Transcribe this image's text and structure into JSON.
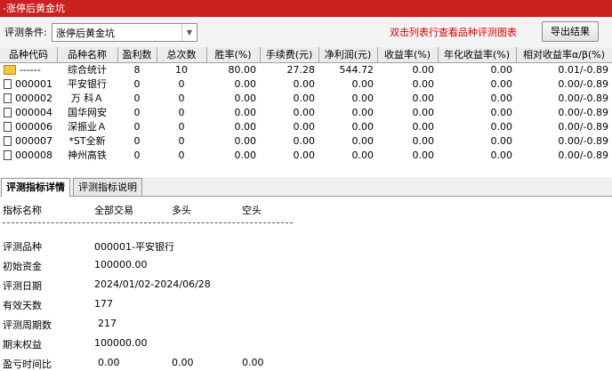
{
  "window": {
    "title": "-涨停后黄金坑"
  },
  "toolbar": {
    "condition_label": "评测条件:",
    "condition_value": "涨停后黄金坑",
    "hint": "双击列表行查看品种评测图表",
    "export_label": "导出结果"
  },
  "table": {
    "headers": [
      "品种代码",
      "品种名称",
      "盈利数",
      "总次数",
      "胜率(%)",
      "手续费(元)",
      "净利润(元)",
      "收益率(%)",
      "年化收益率(%)",
      "相对收益率α/β(%)"
    ],
    "rows": [
      {
        "code": "------",
        "name": "综合统计",
        "wins": "8",
        "total": "10",
        "win_rate": "80.00",
        "fee": "27.28",
        "profit": "544.72",
        "ret": "0.00",
        "annual": "0.00",
        "rel": "0.01/-0.89",
        "icon": "folder-icon"
      },
      {
        "code": "000001",
        "name": "平安银行",
        "wins": "0",
        "total": "0",
        "win_rate": "0.00",
        "fee": "0.00",
        "profit": "0.00",
        "ret": "0.00",
        "annual": "0.00",
        "rel": "0.00/-0.89",
        "icon": "document-icon"
      },
      {
        "code": "000002",
        "name": "万 科Ａ",
        "wins": "0",
        "total": "0",
        "win_rate": "0.00",
        "fee": "0.00",
        "profit": "0.00",
        "ret": "0.00",
        "annual": "0.00",
        "rel": "0.00/-0.89",
        "icon": "document-icon"
      },
      {
        "code": "000004",
        "name": "国华网安",
        "wins": "0",
        "total": "0",
        "win_rate": "0.00",
        "fee": "0.00",
        "profit": "0.00",
        "ret": "0.00",
        "annual": "0.00",
        "rel": "0.00/-0.89",
        "icon": "document-icon"
      },
      {
        "code": "000006",
        "name": "深振业Ａ",
        "wins": "0",
        "total": "0",
        "win_rate": "0.00",
        "fee": "0.00",
        "profit": "0.00",
        "ret": "0.00",
        "annual": "0.00",
        "rel": "0.00/-0.89",
        "icon": "document-icon"
      },
      {
        "code": "000007",
        "name": "*ST全新",
        "wins": "0",
        "total": "0",
        "win_rate": "0.00",
        "fee": "0.00",
        "profit": "0.00",
        "ret": "0.00",
        "annual": "0.00",
        "rel": "0.00/-0.89",
        "icon": "document-icon"
      },
      {
        "code": "000008",
        "name": "神州高铁",
        "wins": "0",
        "total": "0",
        "win_rate": "0.00",
        "fee": "0.00",
        "profit": "0.00",
        "ret": "0.00",
        "annual": "0.00",
        "rel": "0.00/-0.89",
        "icon": "document-icon"
      }
    ]
  },
  "tabs": [
    {
      "label": "评测指标详情",
      "active": true
    },
    {
      "label": "评测指标说明",
      "active": false
    }
  ],
  "details": {
    "header": {
      "name": "指标名称",
      "all": "全部交易",
      "long": "多头",
      "short": "空头"
    },
    "rows": [
      {
        "label": "评测品种",
        "value": "000001-平安银行"
      },
      {
        "label": "初始资金",
        "value": "100000.00"
      },
      {
        "label": "评测日期",
        "value": "2024/01/02-2024/06/28"
      },
      {
        "label": "有效天数",
        "value": "177"
      },
      {
        "label": "评测周期数",
        "value": "217"
      },
      {
        "label": "期末权益",
        "value": "100000.00"
      }
    ],
    "last_row": {
      "label": "盈亏时间比",
      "all": "0.00",
      "long": "0.00",
      "short": "0.00"
    }
  },
  "colors": {
    "titlebar": "#c8211f",
    "hint": "#e00000"
  }
}
